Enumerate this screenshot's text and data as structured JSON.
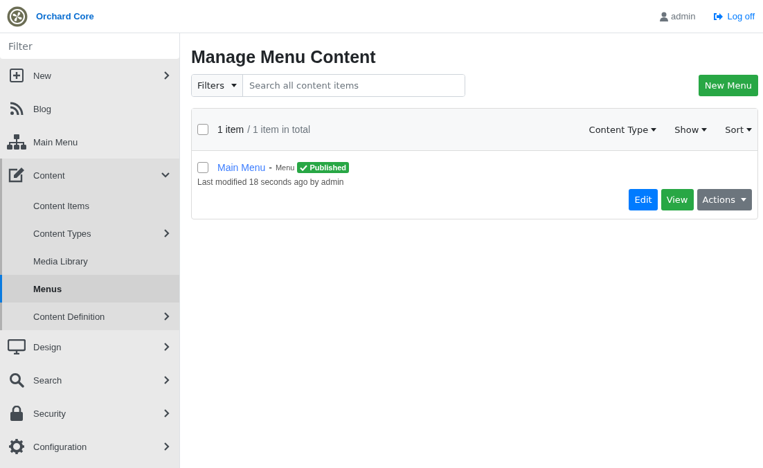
{
  "header": {
    "brand": "Orchard Core",
    "user": "admin",
    "logoff": "Log off"
  },
  "sidebar": {
    "filter_placeholder": "Filter",
    "items": [
      {
        "label": "New",
        "kind": "new",
        "has_submenu": true,
        "expanded": false
      },
      {
        "label": "Blog",
        "kind": "feed",
        "has_submenu": false,
        "expanded": false
      },
      {
        "label": "Main Menu",
        "kind": "tree",
        "has_submenu": false,
        "expanded": false
      },
      {
        "label": "Content",
        "kind": "content",
        "has_submenu": true,
        "expanded": true,
        "children": [
          {
            "label": "Content Items",
            "has_submenu": false,
            "selected": false
          },
          {
            "label": "Content Types",
            "has_submenu": true,
            "selected": false
          },
          {
            "label": "Media Library",
            "has_submenu": false,
            "selected": false
          },
          {
            "label": "Menus",
            "has_submenu": false,
            "selected": true
          },
          {
            "label": "Content Definition",
            "has_submenu": true,
            "selected": false
          }
        ]
      },
      {
        "label": "Design",
        "kind": "design",
        "has_submenu": true,
        "expanded": false
      },
      {
        "label": "Search",
        "kind": "search",
        "has_submenu": true,
        "expanded": false
      },
      {
        "label": "Security",
        "kind": "security",
        "has_submenu": true,
        "expanded": false
      },
      {
        "label": "Configuration",
        "kind": "configuration",
        "has_submenu": true,
        "expanded": false
      }
    ]
  },
  "main": {
    "title": "Manage Menu Content",
    "filters_button": "Filters",
    "search_placeholder": "Search all content items",
    "new_button": "New Menu",
    "list": {
      "select_all_checked": false,
      "count": "1 item",
      "total": "/ 1 item in total",
      "dropdowns": [
        "Content Type",
        "Show",
        "Sort"
      ],
      "rows": [
        {
          "checked": false,
          "title": "Main Menu",
          "separator": "-",
          "type": "Menu",
          "status": "Published",
          "modified": "Last modified 18 seconds ago by admin",
          "buttons": [
            {
              "label": "Edit",
              "kind": "primary",
              "dropdown": false
            },
            {
              "label": "View",
              "kind": "success",
              "dropdown": false
            },
            {
              "label": "Actions",
              "kind": "secondary",
              "dropdown": true
            }
          ]
        }
      ]
    }
  }
}
